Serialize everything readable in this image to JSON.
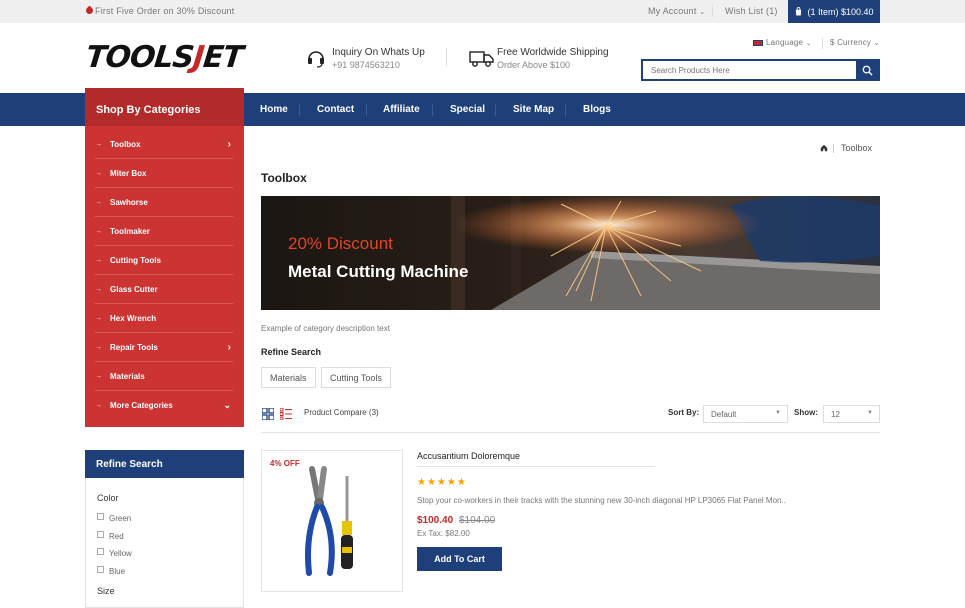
{
  "topbar": {
    "promo": "First Five Order on 30% Discount",
    "my_account": "My Account",
    "wishlist": "Wish List (1)",
    "cart": "(1 Item) $100.40"
  },
  "header": {
    "logo_part1": "TOOLS",
    "logo_part2": "J",
    "logo_part3": "ET",
    "inquiry_title": "Inquiry On Whats Up",
    "inquiry_phone": "+91 9874563210",
    "shipping_title": "Free Worldwide Shipping",
    "shipping_sub": "Order Above $100",
    "language": "Language",
    "currency": "$ Currency",
    "search_placeholder": "Search Products Here"
  },
  "nav": {
    "items": [
      "Home",
      "Contact",
      "Affiliate",
      "Special",
      "Site Map",
      "Blogs"
    ]
  },
  "categories": {
    "title": "Shop By Categories",
    "items": [
      "Toolbox",
      "Miter Box",
      "Sawhorse",
      "Toolmaker",
      "Cutting Tools",
      "Glass Cutter",
      "Hex Wrench",
      "Repair Tools",
      "Materials",
      "More Categories"
    ]
  },
  "refine_sidebar": {
    "title": "Refine Search",
    "color_label": "Color",
    "colors": [
      "Green",
      "Red",
      "Yellow",
      "Blue"
    ],
    "size_label": "Size"
  },
  "breadcrumb": {
    "current": "Toolbox"
  },
  "main": {
    "title": "Toolbox",
    "banner_discount": "20% Discount",
    "banner_title": "Metal Cutting Machine",
    "description": "Example of category description text",
    "refine_title": "Refine Search",
    "refine_buttons": [
      "Materials",
      "Cutting Tools"
    ],
    "product_compare": "Product Compare (3)",
    "sort_label": "Sort By:",
    "sort_value": "Default",
    "show_label": "Show:",
    "show_value": "12"
  },
  "product": {
    "badge": "4% OFF",
    "name": "Accusantium Doloremque",
    "rating": 5,
    "stars": "★★★★★",
    "description": "Stop your co-workers in their tracks with the stunning new 30-inch diagonal HP LP3065 Flat Panel Mon..",
    "price_new": "$100.40",
    "price_old": "$104.00",
    "ex_tax": "Ex Tax: $82.00",
    "add_to_cart": "Add To Cart"
  },
  "colors": {
    "primary_blue": "#1e3f7a",
    "primary_red": "#cc3333",
    "price_red": "#c62828",
    "star": "#f5a300"
  }
}
